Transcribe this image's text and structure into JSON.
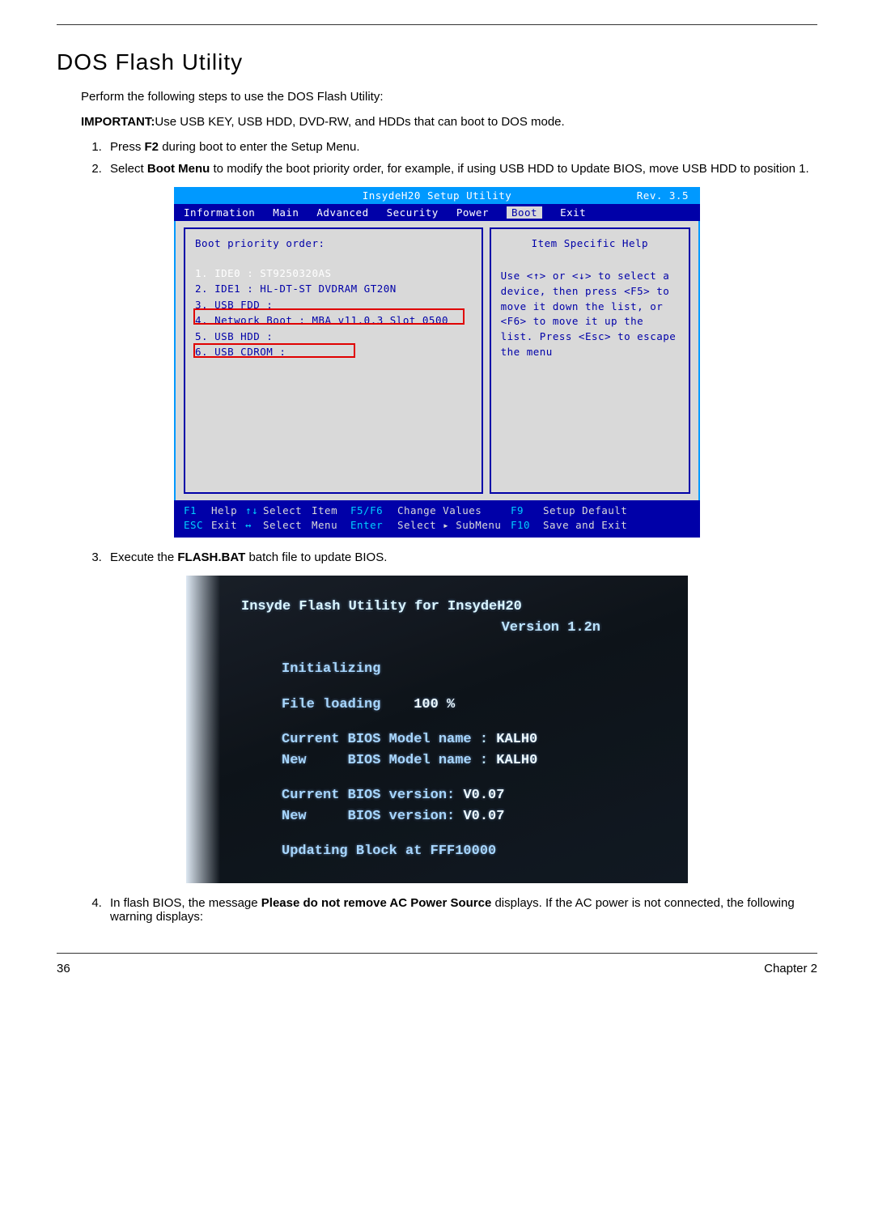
{
  "heading": "DOS Flash Utility",
  "intro": "Perform the following steps to use the DOS Flash Utility:",
  "important_prefix": "IMPORTANT:",
  "important_text": "Use USB KEY, USB HDD, DVD-RW, and HDDs that can boot to DOS mode.",
  "steps": {
    "s1a": "Press ",
    "s1b": "F2",
    "s1c": " during boot to enter the Setup Menu.",
    "s2a": "Select ",
    "s2b": "Boot Menu",
    "s2c": " to modify the boot priority order, for example, if using USB HDD to Update BIOS, move USB HDD to position 1.",
    "s3a": "Execute the ",
    "s3b": "FLASH.BAT",
    "s3c": " batch file to update BIOS.",
    "s4a": "In flash BIOS, the message ",
    "s4b": "Please do not remove AC Power Source",
    "s4c": " displays. If the AC power is not connected, the following warning displays:"
  },
  "bios": {
    "title": "InsydeH20 Setup Utility",
    "rev": "Rev. 3.5",
    "tabs": [
      "Information",
      "Main",
      "Advanced",
      "Security",
      "Power",
      "Boot",
      "Exit"
    ],
    "active_tab_index": 5,
    "left_title": "Boot priority order:",
    "boot_items": [
      "1. IDE0 : ST9250320AS",
      "2. IDE1 : HL-DT-ST DVDRAM GT20N",
      "3. USB FDD :",
      "4. Network Boot : MBA v11.0.3 Slot 0500",
      "5. USB HDD :",
      "6. USB CDROM :"
    ],
    "help_title": "Item Specific Help",
    "help_body": "Use <↑> or <↓> to select a device, then press <F5> to move it down the list, or <F6> to move it up the list. Press <Esc> to escape the menu",
    "footer": {
      "r1": {
        "k1": "F1",
        "t1": "Help",
        "k2": "↑↓",
        "t2": "Select",
        "t2b": "Item",
        "k3": "F5/F6",
        "t3": "Change Values",
        "k4": "F9",
        "t4": "Setup Default"
      },
      "r2": {
        "k1": "ESC",
        "t1": "Exit",
        "k2": "↔",
        "t2": "Select",
        "t2b": "Menu",
        "k3": "Enter",
        "t3": "Select  ▸ SubMenu",
        "k4": "F10",
        "t4": "Save and Exit"
      }
    }
  },
  "dos": {
    "title": "Insyde Flash Utility for InsydeH20",
    "version": "Version 1.2n",
    "init": "Initializing",
    "loading_label": "File loading",
    "loading_value": "100 %",
    "cur_model_label": "Current BIOS Model name",
    "cur_model_value": "KALH0",
    "new_model_label1": "New",
    "new_model_label2": "BIOS Model name",
    "new_model_value": "KALH0",
    "cur_ver_label": "Current BIOS version:",
    "cur_ver_value": "V0.07",
    "new_ver_label1": "New",
    "new_ver_label2": "BIOS version:",
    "new_ver_value": "V0.07",
    "updating": "Updating Block at FFF10000"
  },
  "page": {
    "number": "36",
    "chapter": "Chapter 2"
  }
}
